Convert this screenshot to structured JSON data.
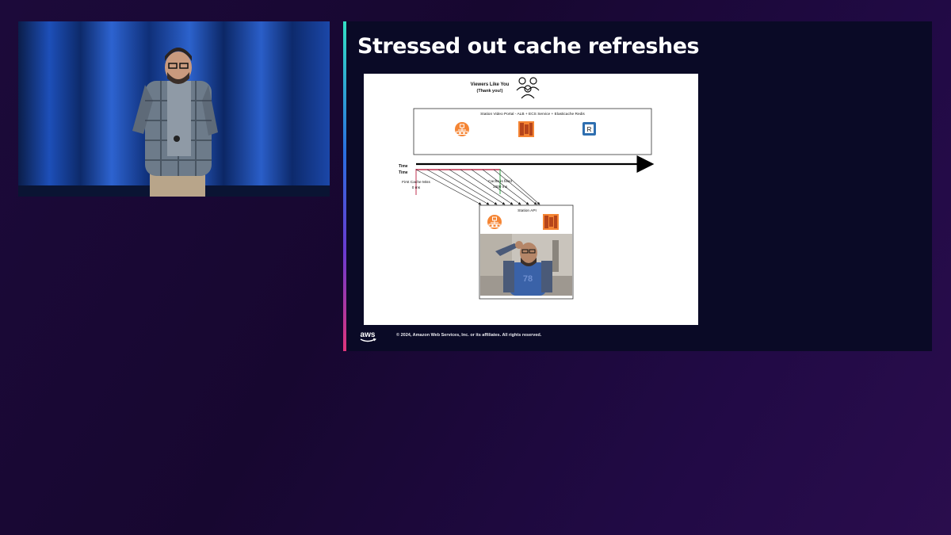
{
  "slide": {
    "title": "Stressed out cache refreshes",
    "footer": "© 2024, Amazon Web Services, Inc. or its affiliates. All rights reserved.",
    "logo_text": "aws",
    "accent_colors": [
      "#33e0c4",
      "#2a6fe0",
      "#6a3ad0",
      "#e0357a"
    ]
  },
  "diagram": {
    "viewers_title": "Viewers Like You",
    "viewers_subtitle": "(Thank you!)",
    "portal_label": "Station Video Portal - ALB + ECS Service + Elasticache Redis",
    "portal_icons": [
      "load-balancer-icon",
      "ecs-icon",
      "redis-icon"
    ],
    "redis_letter": "R",
    "time_label_1": "Time",
    "time_label_2": "Time",
    "first_miss_label": "First Cache Miss",
    "first_miss_time": "0 ms",
    "cache_filled_label": "Cache is filled",
    "cache_filled_time": "1000 ms",
    "api_label": "Station API",
    "api_icons": [
      "load-balancer-icon",
      "ecs-icon"
    ],
    "colors": {
      "aws_orange": "#f58534",
      "redis_blue": "#2f6fb0",
      "miss_red": "#c0304f",
      "fill_green": "#37b24d"
    }
  }
}
